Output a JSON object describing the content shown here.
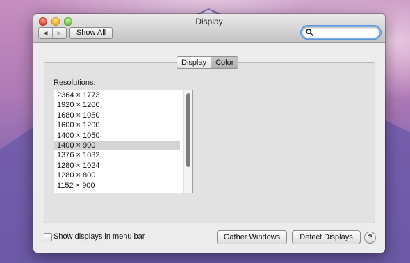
{
  "window": {
    "title": "Display"
  },
  "toolbar": {
    "back_glyph": "◀",
    "forward_glyph": "▶",
    "show_all_label": "Show All",
    "search_placeholder": "",
    "search_value": ""
  },
  "tabs": [
    {
      "label": "Display",
      "active": false
    },
    {
      "label": "Color",
      "active": true
    }
  ],
  "resolutions": {
    "label": "Resolutions:",
    "items": [
      "2364 × 1773",
      "1920 × 1200",
      "1680 × 1050",
      "1600 × 1200",
      "1400 × 1050",
      "1400 × 900",
      "1376 × 1032",
      "1280 × 1024",
      "1280 × 800",
      "1152 × 900"
    ],
    "selected": "1400 × 900"
  },
  "footer": {
    "checkbox_label": "Show displays in menu bar",
    "checkbox_checked": false,
    "gather_label": "Gather Windows",
    "detect_label": "Detect Displays",
    "help_label": "?"
  },
  "icons": {
    "close": "close-icon",
    "minimize": "minimize-icon",
    "zoom": "zoom-icon",
    "search": "search-icon",
    "help": "help-icon"
  }
}
